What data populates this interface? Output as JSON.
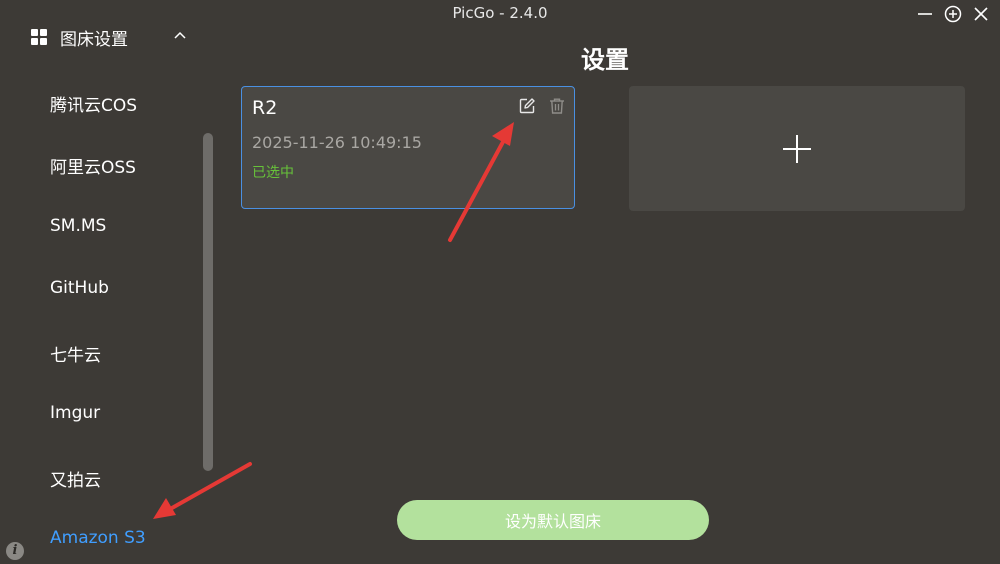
{
  "window": {
    "title": "PicGo - 2.4.0"
  },
  "sidebar": {
    "header_label": "图床设置",
    "items": [
      {
        "label": "腾讯云COS"
      },
      {
        "label": "阿里云OSS"
      },
      {
        "label": "SM.MS"
      },
      {
        "label": "GitHub"
      },
      {
        "label": "七牛云"
      },
      {
        "label": "Imgur"
      },
      {
        "label": "又拍云"
      },
      {
        "label": "Amazon S3",
        "active": true
      }
    ]
  },
  "main": {
    "title": "设置",
    "config_card": {
      "name": "R2",
      "date": "2025-11-26 10:49:15",
      "status": "已选中"
    },
    "set_default_label": "设为默认图床"
  },
  "colors": {
    "background": "#3d3a36",
    "card": "#4a4844",
    "accent": "#409eff",
    "selected_border": "#4a90e2",
    "status_green": "#67c23a",
    "button_green": "#b3e19d",
    "arrow_red": "#e53935"
  },
  "icons": {
    "window": [
      "minimize-icon",
      "plus-circle-icon",
      "close-icon"
    ],
    "sidebar": [
      "grid-icon",
      "chevron-up-icon",
      "info-icon"
    ],
    "card": [
      "edit-icon",
      "trash-icon"
    ],
    "add": "plus-icon"
  }
}
